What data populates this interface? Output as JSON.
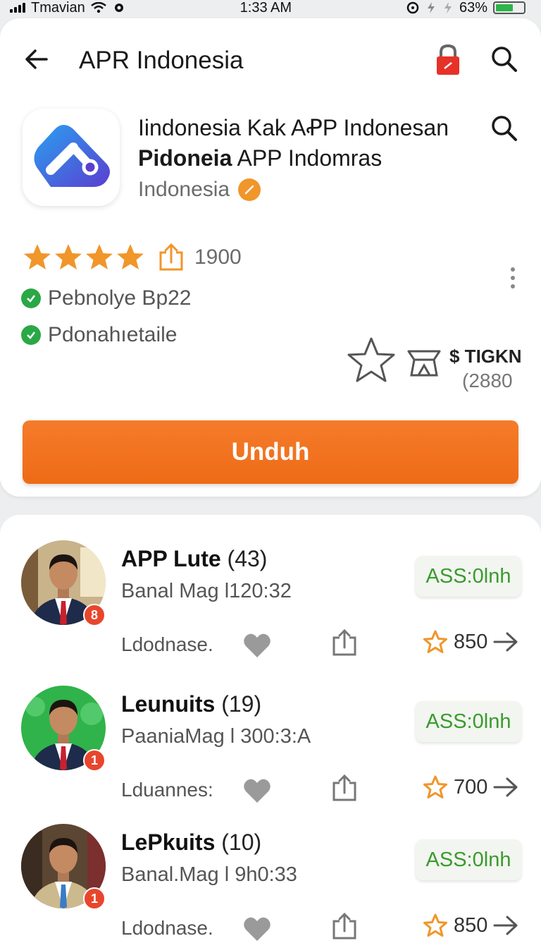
{
  "status_bar": {
    "carrier": "Tmavian",
    "time": "1:33 AM",
    "battery": "63%",
    "battery_level": 0.63
  },
  "app_bar": {
    "title": "APR Indonesia"
  },
  "app": {
    "name_line1": "Iindonesia Kak AꝒP Indonesan",
    "name_line2_bold": "Pidoneia",
    "name_line2_rest": " APP Indomras",
    "developer": "Indonesia",
    "rating_stars": 4,
    "rating_count": "1900",
    "features": [
      "Pebnolye Bp22",
      "Pdonahıetaile"
    ],
    "price_label": "$ TIGKN",
    "price_sub": "(2880",
    "download_label": "Unduh"
  },
  "colors": {
    "accent": "#ee6b17",
    "star": "#f0962a",
    "check": "#2aa845",
    "status_chip_text": "#3a9b2e",
    "icon_gradient": [
      "#2aa0f0",
      "#5a3fd0"
    ]
  },
  "list": [
    {
      "title": "APP Lute",
      "count": "(43)",
      "subtitle": "Banal Mag l120:32",
      "status": "ASS:0lnh",
      "footer": "Ldodnase.",
      "rating": "850",
      "badge": "8",
      "avatar_bg": "office"
    },
    {
      "title": "Leunuits",
      "count": "(19)",
      "subtitle": "PaaniaMag l 300:3:A",
      "status": "ASS:0lnh",
      "footer": "Lduannes:",
      "rating": "700",
      "badge": "1",
      "avatar_bg": "green"
    },
    {
      "title": "LePkuits",
      "count": "(10)",
      "subtitle": "Banal.Mag l 9h0:33",
      "status": "ASS:0lnh",
      "footer": "Ldodnase.",
      "rating": "850",
      "badge": "1",
      "avatar_bg": "books"
    }
  ]
}
